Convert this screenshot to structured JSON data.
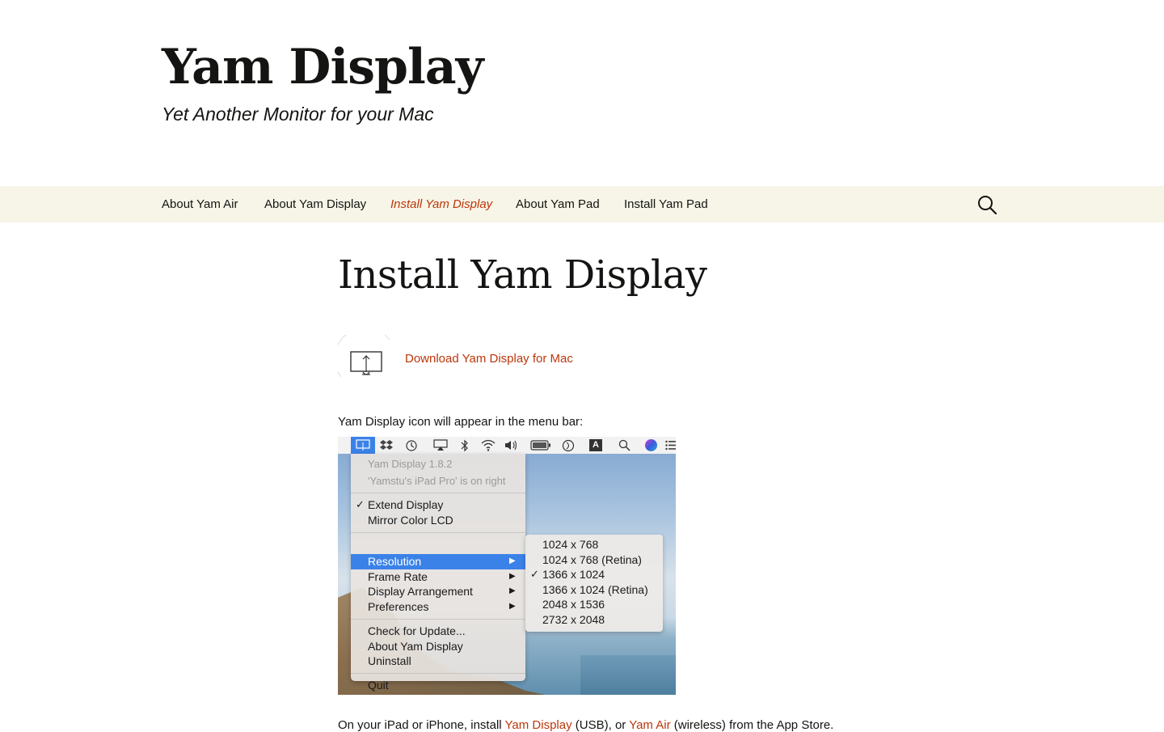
{
  "site": {
    "title": "Yam Display",
    "tagline": "Yet Another Monitor for your Mac"
  },
  "nav": {
    "items": [
      {
        "label": "About Yam Air",
        "active": false
      },
      {
        "label": "About Yam Display",
        "active": false
      },
      {
        "label": "Install Yam Display",
        "active": true
      },
      {
        "label": "About Yam Pad",
        "active": false
      },
      {
        "label": "Install Yam Pad",
        "active": false
      }
    ],
    "search_icon": "search-icon"
  },
  "page": {
    "title": "Install Yam Display",
    "download_link": "Download Yam Display for Mac",
    "menubar_intro": "Yam Display icon will appear in the menu bar:",
    "bottom_text_prefix": "On your iPad or iPhone, install ",
    "bottom_link_1": "Yam Display",
    "bottom_text_mid": " (USB), or ",
    "bottom_link_2": "Yam Air",
    "bottom_text_suffix": " (wireless) from the App Store."
  },
  "screenshot": {
    "menu_items": {
      "version": "Yam Display 1.8.2",
      "status": "'Yamstu's iPad Pro' is on right",
      "extend": "Extend Display",
      "mirror": "Mirror Color LCD",
      "resolution": "Resolution",
      "frame_rate": "Frame Rate",
      "arrangement": "Display Arrangement",
      "preferences": "Preferences",
      "check_update": "Check for Update...",
      "about": "About Yam Display",
      "uninstall": "Uninstall",
      "quit": "Quit"
    },
    "resolutions": [
      "1024 x 768",
      "1024 x 768 (Retina)",
      "1366 x 1024",
      "1366 x 1024 (Retina)",
      "2048 x 1536",
      "2732 x 2048"
    ],
    "selected_resolution": "1366 x 1024",
    "checked_mode": "Extend Display",
    "menubar_glyph": "A",
    "check_glyph": "✓",
    "arrow_glyph": "▶"
  },
  "colors": {
    "accent": "#bc360a",
    "navbar_bg": "#f7f5e7",
    "menu_highlight": "#3b82e8"
  }
}
